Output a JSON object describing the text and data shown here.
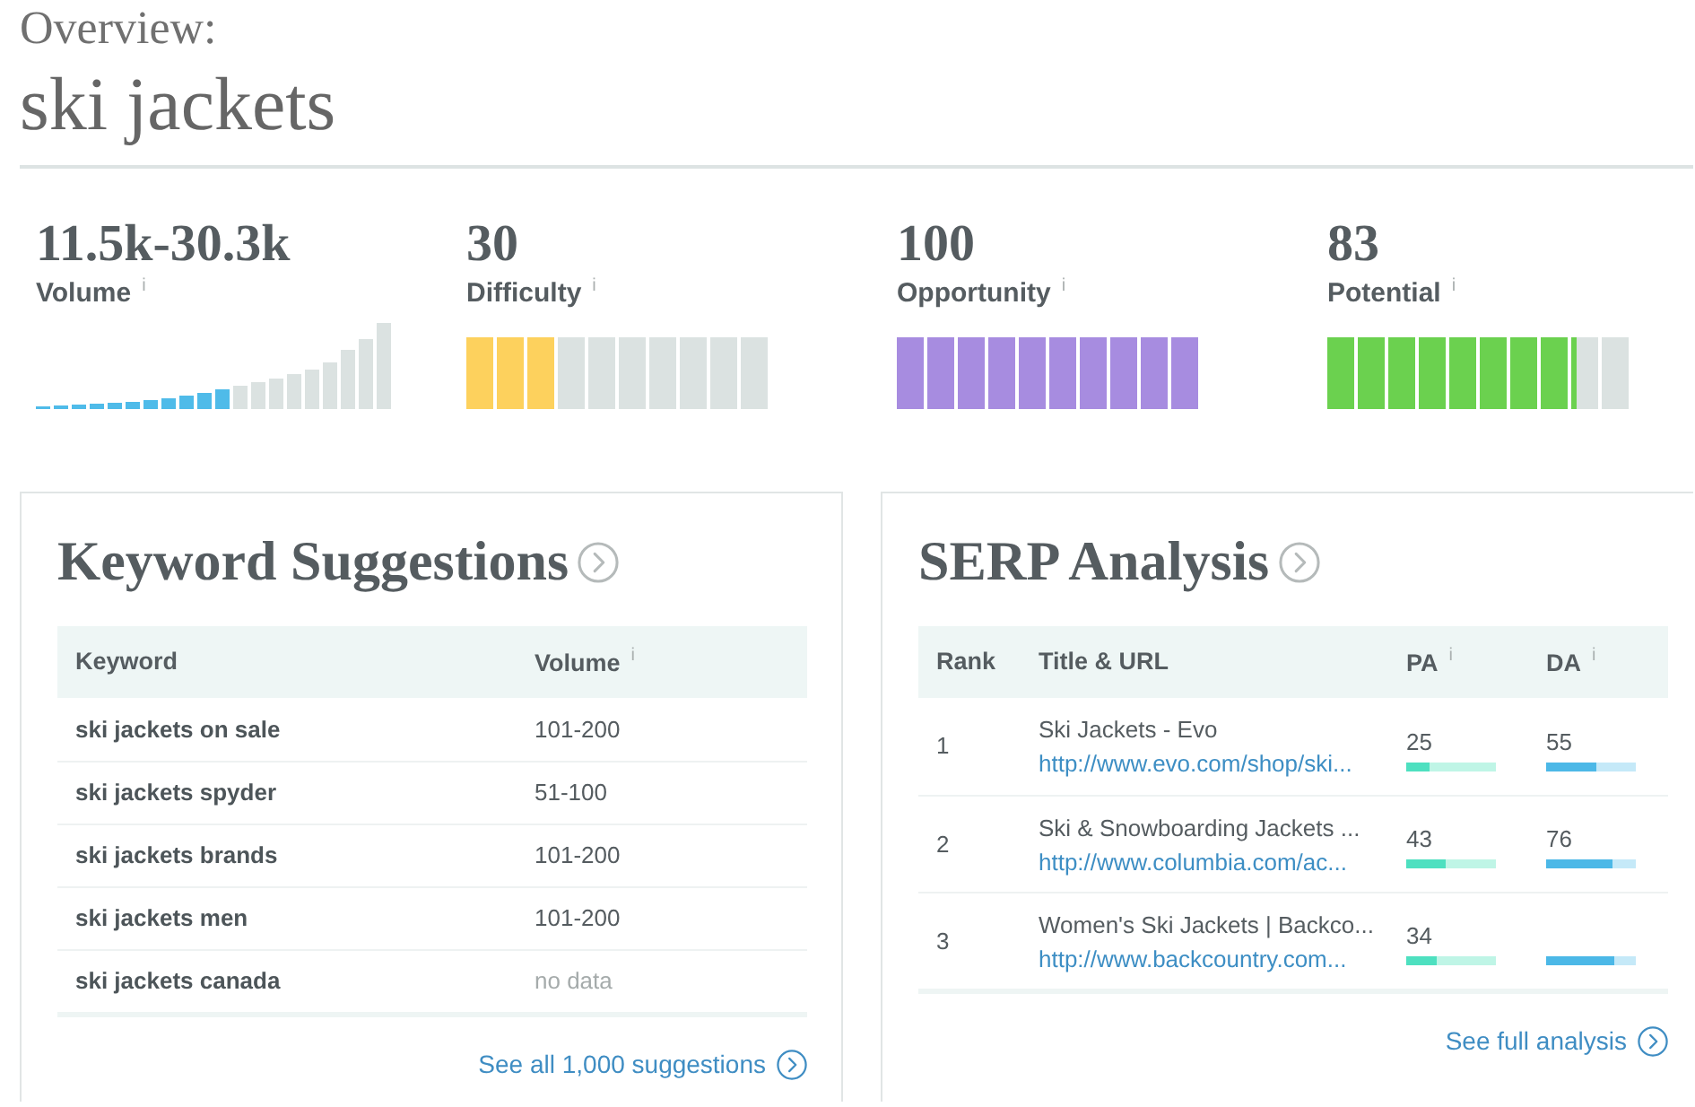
{
  "header": {
    "label": "Overview:",
    "keyword": "ski jackets"
  },
  "metrics": [
    {
      "kind": "histogram",
      "value": "11.5k-30.3k",
      "label": "Volume",
      "info": "i",
      "level": 0.55,
      "color": "#4fbbe9"
    },
    {
      "kind": "segments",
      "value": "30",
      "label": "Difficulty",
      "info": "i",
      "level": 0.3,
      "color": "#fdd15d"
    },
    {
      "kind": "segments",
      "value": "100",
      "label": "Opportunity",
      "info": "i",
      "level": 1,
      "color": "#a78ce0"
    },
    {
      "kind": "segments",
      "value": "83",
      "label": "Potential",
      "info": "i",
      "level": 0.83,
      "color": "#6bd14f"
    }
  ],
  "keyword_suggestions": {
    "title": "Keyword Suggestions",
    "columns": [
      {
        "label": "Keyword"
      },
      {
        "label": "Volume",
        "info": "i"
      }
    ],
    "rows": [
      {
        "keyword": "ski jackets on sale",
        "volume": "101-200",
        "no_data": false
      },
      {
        "keyword": "ski jackets spyder",
        "volume": "51-100",
        "no_data": false
      },
      {
        "keyword": "ski jackets brands",
        "volume": "101-200",
        "no_data": false
      },
      {
        "keyword": "ski jackets men",
        "volume": "101-200",
        "no_data": false
      },
      {
        "keyword": "ski jackets canada",
        "volume": "no data",
        "no_data": true
      }
    ],
    "link": "See all 1,000 suggestions"
  },
  "serp_analysis": {
    "title": "SERP Analysis",
    "columns": [
      {
        "label": "Rank"
      },
      {
        "label": "Title & URL"
      },
      {
        "label": "PA",
        "info": "i"
      },
      {
        "label": "DA",
        "info": "i"
      }
    ],
    "rows": [
      {
        "rank": "1",
        "title": "Ski Jackets - Evo",
        "url": "http://www.evo.com/shop/ski...",
        "pa": {
          "value": "25",
          "level": 0.25
        },
        "da": {
          "value": "55",
          "level": 0.55
        }
      },
      {
        "rank": "2",
        "title": "Ski & Snowboarding Jackets ...",
        "url": "http://www.columbia.com/ac...",
        "pa": {
          "value": "43",
          "level": 0.43
        },
        "da": {
          "value": "76",
          "level": 0.74
        }
      },
      {
        "rank": "3",
        "title": "Women's Ski Jackets | Backco...",
        "url": "http://www.backcountry.com...",
        "pa": {
          "value": "34",
          "level": 0.34
        },
        "da": {
          "level": 0.76
        }
      }
    ],
    "link": "See full analysis"
  }
}
